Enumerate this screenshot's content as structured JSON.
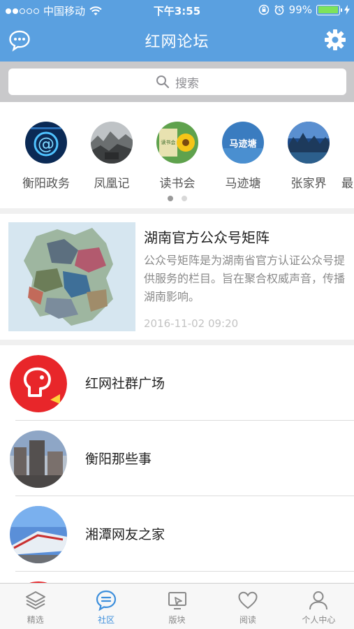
{
  "status_bar": {
    "carrier": "中国移动",
    "time": "下午3:55",
    "battery_percent": "99%",
    "battery_level": 0.99
  },
  "nav": {
    "title": "红网论坛",
    "left_icon": "chat-bubble-icon",
    "right_icon": "gear-icon"
  },
  "search": {
    "placeholder": "搜索",
    "icon": "search-icon"
  },
  "categories": [
    {
      "label": "衡阳政务"
    },
    {
      "label": "凤凰记"
    },
    {
      "label": "读书会"
    },
    {
      "label": "马迹塘"
    },
    {
      "label": "张家界"
    },
    {
      "label": "最"
    }
  ],
  "category_badge_texts": {
    "reading": "读书会",
    "majitang": "马迹塘"
  },
  "pager": {
    "pages": 2,
    "active": 1
  },
  "feature": {
    "title": "湖南官方公众号矩阵",
    "description": "公众号矩阵是为湖南省官方认证公众号提供服务的栏目。旨在聚合权威声音，传播湖南影响。",
    "time": "2016-11-02 09:20"
  },
  "list": [
    {
      "label": "红网社群广场"
    },
    {
      "label": "衡阳那些事"
    },
    {
      "label": "湘潭网友之家"
    }
  ],
  "tabbar": {
    "active": "社区",
    "tabs": [
      {
        "label": "精选",
        "icon": "layers-icon"
      },
      {
        "label": "社区",
        "icon": "chat-bubble-icon"
      },
      {
        "label": "版块",
        "icon": "board-icon"
      },
      {
        "label": "阅读",
        "icon": "heart-icon"
      },
      {
        "label": "个人中心",
        "icon": "person-icon"
      }
    ]
  },
  "colors": {
    "header": "#5aa0e0",
    "accent": "#3d8fdc",
    "battery": "#7ee35b"
  }
}
